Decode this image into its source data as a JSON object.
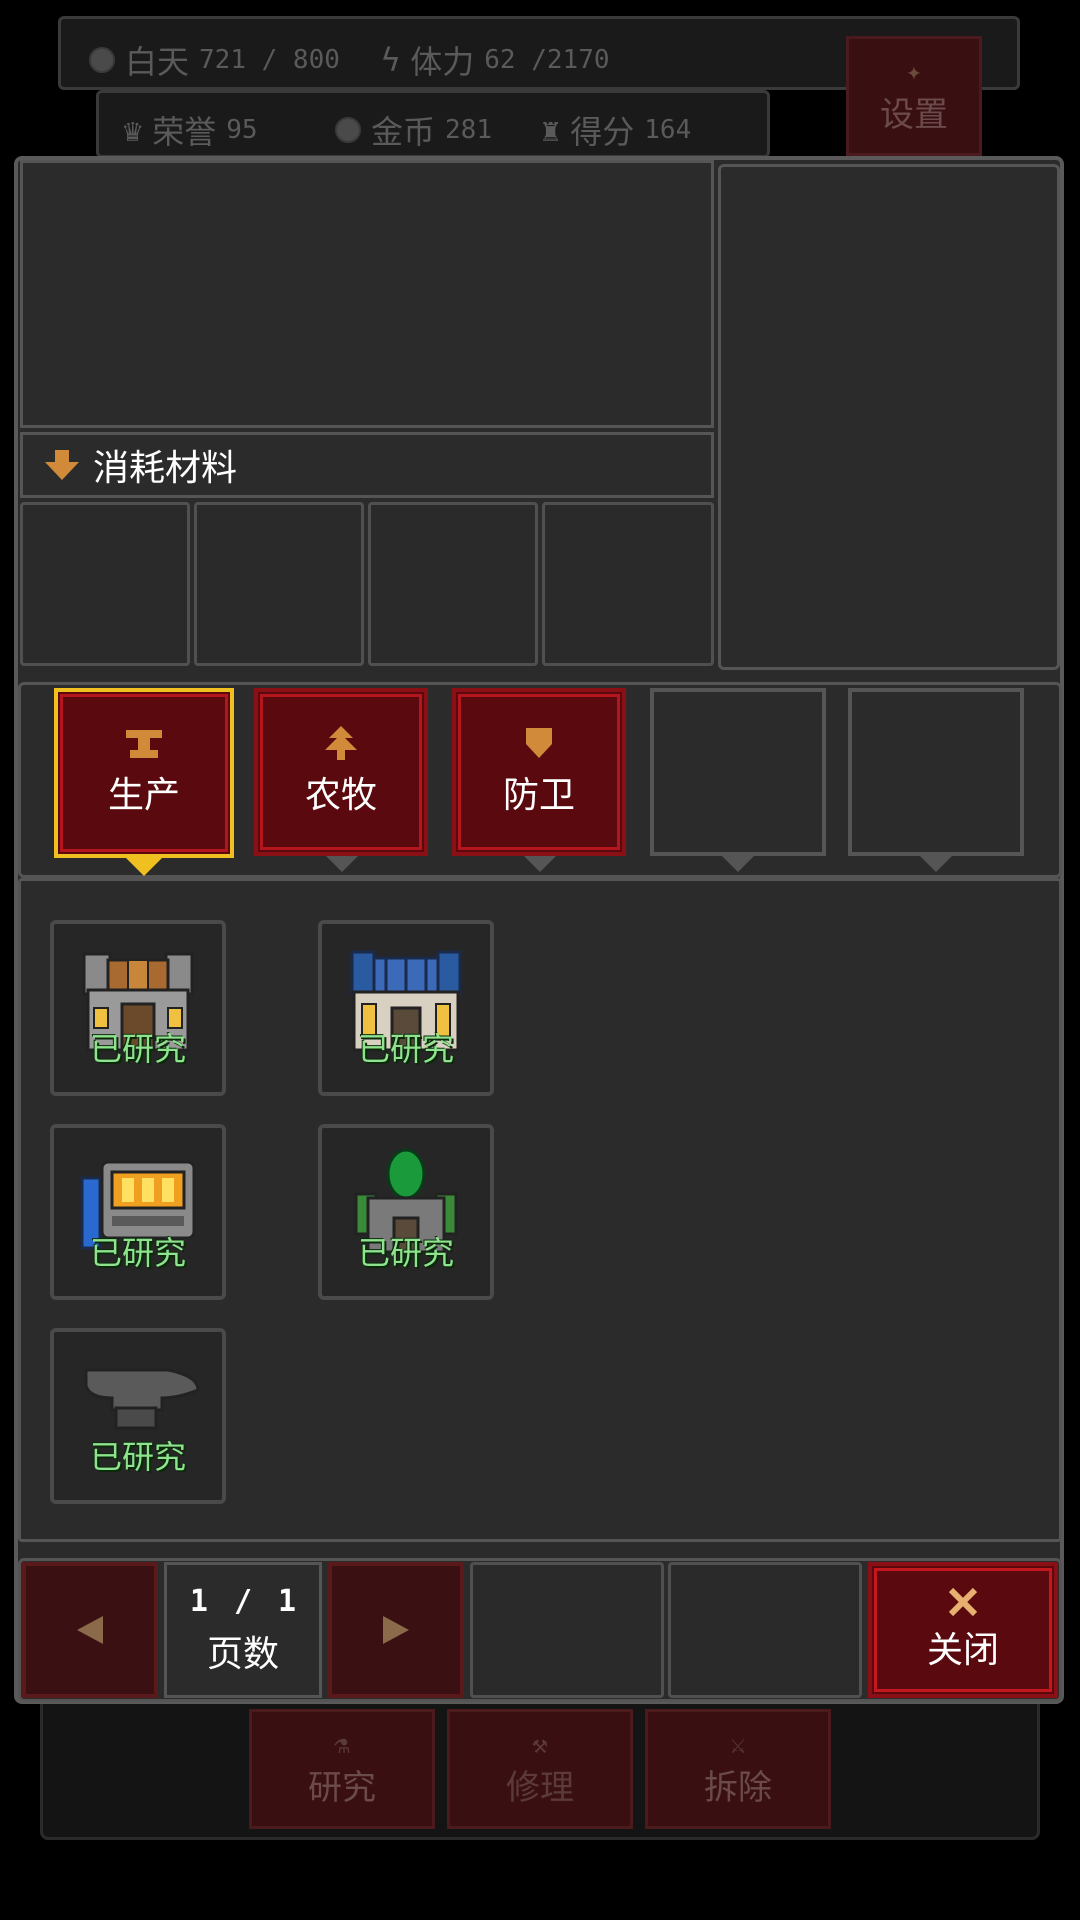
{
  "hud": {
    "day_label": "白天",
    "day_value": "721 / 800",
    "stamina_label": "体力",
    "stamina_value": "62 /2170",
    "honor_label": "荣誉",
    "honor_value": "95",
    "gold_label": "金币",
    "gold_value": "281",
    "score_label": "得分",
    "score_value": "164",
    "settings_label": "设置"
  },
  "materials": {
    "header": "消耗材料"
  },
  "tabs": [
    {
      "label": "生产",
      "icon": "anvil-icon",
      "selected": true
    },
    {
      "label": "农牧",
      "icon": "tree-icon",
      "selected": false
    },
    {
      "label": "防卫",
      "icon": "shield-icon",
      "selected": false
    },
    {
      "label": "",
      "icon": "",
      "selected": false
    },
    {
      "label": "",
      "icon": "",
      "selected": false
    }
  ],
  "buildings": [
    {
      "name": "workshop-building",
      "status": "已研究"
    },
    {
      "name": "blue-roof-building",
      "status": "已研究"
    },
    {
      "name": "furnace-building",
      "status": "已研究"
    },
    {
      "name": "green-dome-building",
      "status": "已研究"
    },
    {
      "name": "anvil-building",
      "status": "已研究"
    }
  ],
  "pagination": {
    "current": "1",
    "separator": "/",
    "total": "1",
    "label": "页数"
  },
  "close_label": "关闭",
  "bottom_bar": {
    "research": "研究",
    "repair": "修理",
    "demolish": "拆除"
  },
  "colors": {
    "accent_red": "#8a1015",
    "selected_border": "#f0c020",
    "researched_green": "#8fe38f"
  }
}
